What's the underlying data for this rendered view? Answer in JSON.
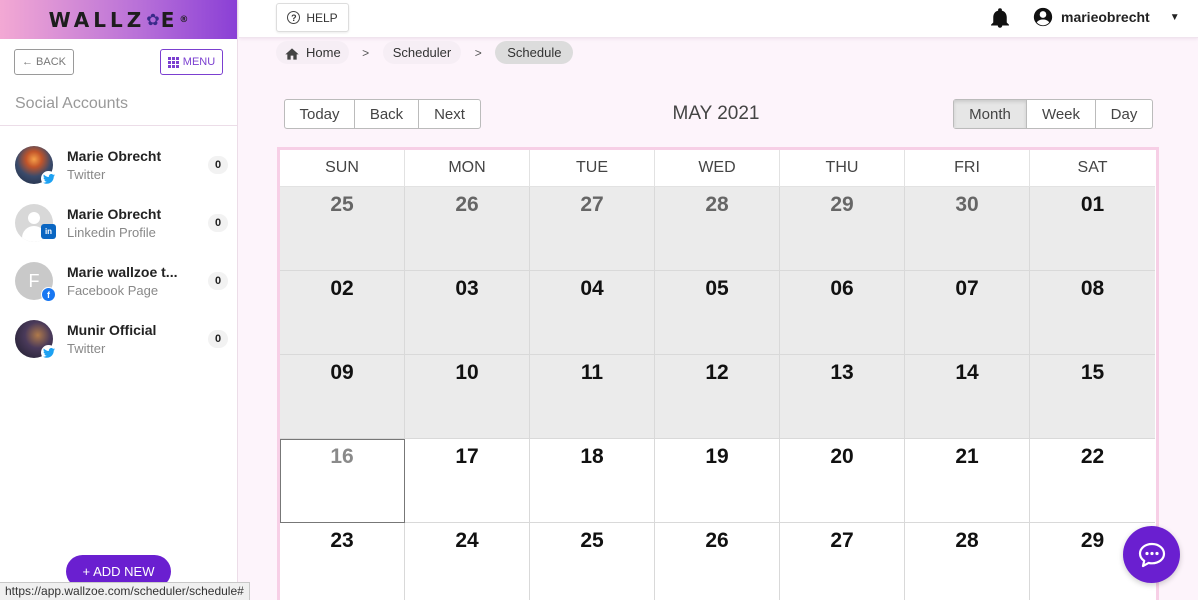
{
  "sidebar": {
    "logo": {
      "left": "WALLZ",
      "right": "E",
      "mark": "®"
    },
    "back_label": "BACK",
    "menu_label": "MENU",
    "section_title": "Social Accounts",
    "accounts": [
      {
        "name": "Marie Obrecht",
        "type": "Twitter",
        "count": "0",
        "network": "twitter-icon"
      },
      {
        "name": "Marie Obrecht",
        "type": "Linkedin Profile",
        "count": "0",
        "network": "linkedin-icon"
      },
      {
        "name": "Marie wallzoe t...",
        "type": "Facebook Page",
        "count": "0",
        "network": "facebook-icon",
        "initial": "F"
      },
      {
        "name": "Munir Official",
        "type": "Twitter",
        "count": "0",
        "network": "twitter-icon"
      }
    ],
    "add_new_label": "ADD NEW",
    "status_url": "https://app.wallzoe.com/scheduler/schedule#"
  },
  "topbar": {
    "help_label": "HELP",
    "username": "marieobrecht"
  },
  "breadcrumb": [
    {
      "label": "Home"
    },
    {
      "label": "Scheduler"
    },
    {
      "label": "Schedule"
    }
  ],
  "calendar": {
    "nav": {
      "today": "Today",
      "back": "Back",
      "next": "Next"
    },
    "title": "MAY 2021",
    "views": {
      "month": "Month",
      "week": "Week",
      "day": "Day",
      "active": "Month"
    },
    "weekdays": [
      "SUN",
      "MON",
      "TUE",
      "WED",
      "THU",
      "FRI",
      "SAT"
    ],
    "weeks": [
      [
        "25",
        "26",
        "27",
        "28",
        "29",
        "30",
        "01"
      ],
      [
        "02",
        "03",
        "04",
        "05",
        "06",
        "07",
        "08"
      ],
      [
        "09",
        "10",
        "11",
        "12",
        "13",
        "14",
        "15"
      ],
      [
        "16",
        "17",
        "18",
        "19",
        "20",
        "21",
        "22"
      ],
      [
        "23",
        "24",
        "25",
        "26",
        "27",
        "28",
        "29"
      ]
    ],
    "today_date": "16"
  },
  "colors": {
    "accent": "#6a1fd0",
    "calendar_border": "#f7cfe6",
    "past_day": "#ebebeb"
  }
}
